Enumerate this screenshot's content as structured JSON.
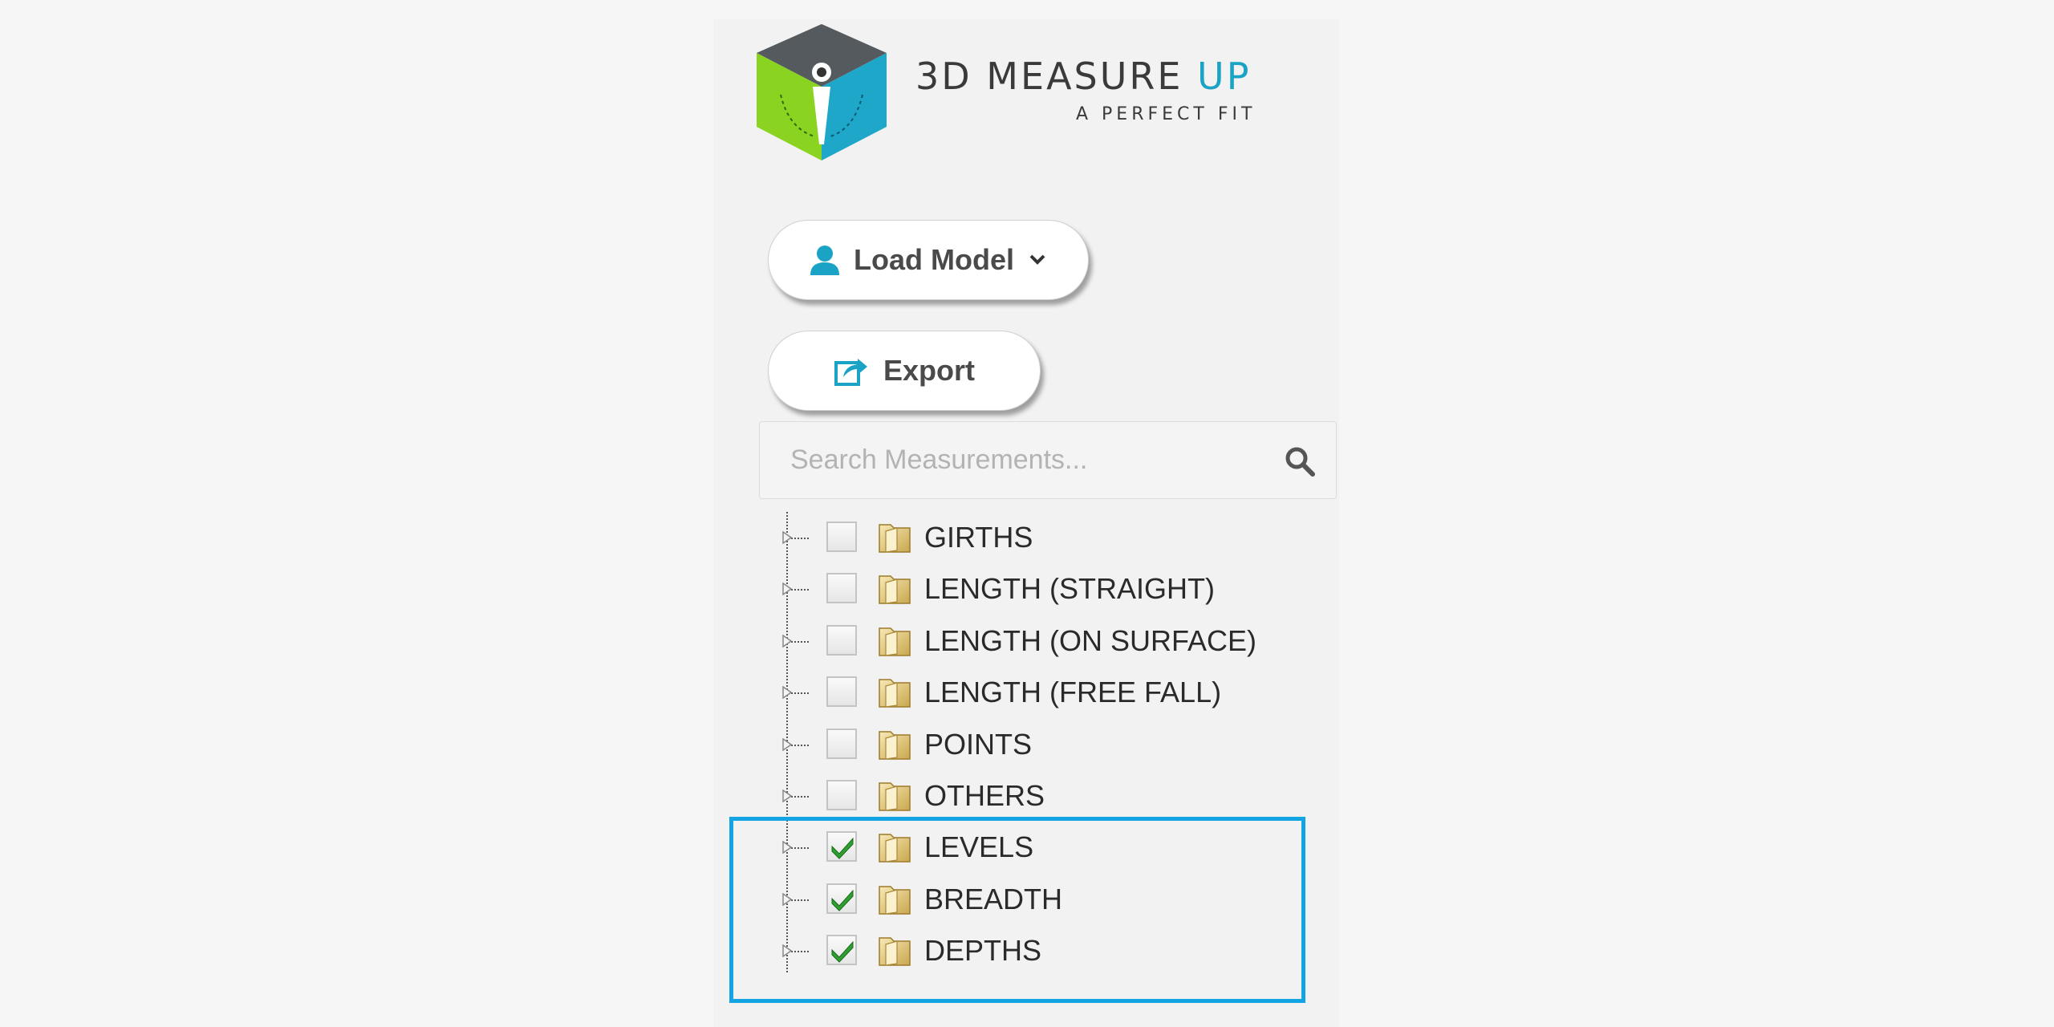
{
  "brand": {
    "title_main": "3D MEASURE ",
    "title_accent": "UP",
    "tagline": "A PERFECT FIT",
    "accent_color": "#1aa3c4"
  },
  "toolbar": {
    "load_model_label": "Load Model",
    "export_label": "Export"
  },
  "search": {
    "placeholder": "Search Measurements...",
    "value": ""
  },
  "tree": {
    "items": [
      {
        "label": "GIRTHS",
        "checked": false
      },
      {
        "label": "LENGTH (STRAIGHT)",
        "checked": false
      },
      {
        "label": "LENGTH (ON SURFACE)",
        "checked": false
      },
      {
        "label": "LENGTH (FREE FALL)",
        "checked": false
      },
      {
        "label": "POINTS",
        "checked": false
      },
      {
        "label": "OTHERS",
        "checked": false
      },
      {
        "label": "LEVELS",
        "checked": true
      },
      {
        "label": "BREADTH",
        "checked": true
      },
      {
        "label": "DEPTHS",
        "checked": true
      }
    ]
  },
  "colors": {
    "highlight": "#13a4e3",
    "check_green": "#2fa02f"
  }
}
